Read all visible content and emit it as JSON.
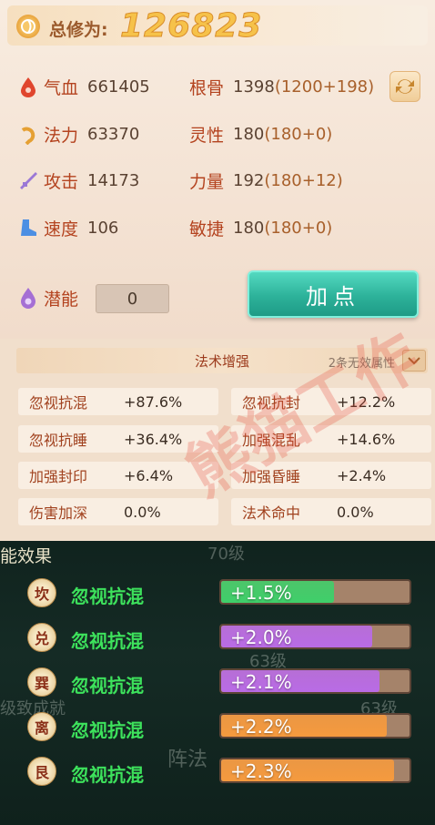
{
  "header": {
    "label": "总修为:",
    "value": "126823"
  },
  "stats": {
    "hp": {
      "name": "气血",
      "value": "661405"
    },
    "mp": {
      "name": "法力",
      "value": "63370"
    },
    "atk": {
      "name": "攻击",
      "value": "14173"
    },
    "spd": {
      "name": "速度",
      "value": "106"
    },
    "root": {
      "name": "根骨",
      "value": "1398",
      "detail": "(1200+198)"
    },
    "spirit": {
      "name": "灵性",
      "value": "180",
      "detail": "(180+0)"
    },
    "power": {
      "name": "力量",
      "value": "192",
      "detail": "(180+12)"
    },
    "agi": {
      "name": "敏捷",
      "value": "180",
      "detail": "(180+0)"
    }
  },
  "potential": {
    "name": "潜能",
    "value": "0"
  },
  "add_button": "加点",
  "magic": {
    "title": "法术增强",
    "hint": "2条无效属性",
    "cells": [
      {
        "name": "忽视抗混",
        "value": "+87.6%"
      },
      {
        "name": "忽视抗封",
        "value": "+12.2%"
      },
      {
        "name": "忽视抗睡",
        "value": "+36.4%"
      },
      {
        "name": "加强混乱",
        "value": "+14.6%"
      },
      {
        "name": "加强封印",
        "value": "+6.4%"
      },
      {
        "name": "加强昏睡",
        "value": "+2.4%"
      },
      {
        "name": "伤害加深",
        "value": "0.0%"
      },
      {
        "name": "法术命中",
        "value": "0.0%"
      }
    ]
  },
  "background_text": {
    "effect": "能效果",
    "level70": "70级",
    "level63": "63级",
    "level63b": "63级",
    "achievement": "级致成就",
    "formation": "阵法"
  },
  "trigram_rows": [
    {
      "symbol": "坎",
      "label": "忽视抗混",
      "bonus": "+1.5%",
      "color": "#3fcf6a",
      "fill": 0.6
    },
    {
      "symbol": "兑",
      "label": "忽视抗混",
      "bonus": "+2.0%",
      "color": "#b96be6",
      "fill": 0.8
    },
    {
      "symbol": "巽",
      "label": "忽视抗混",
      "bonus": "+2.1%",
      "color": "#b96be6",
      "fill": 0.84
    },
    {
      "symbol": "离",
      "label": "忽视抗混",
      "bonus": "+2.2%",
      "color": "#f59a3e",
      "fill": 0.88
    },
    {
      "symbol": "艮",
      "label": "忽视抗混",
      "bonus": "+2.3%",
      "color": "#f59a3e",
      "fill": 0.92
    }
  ],
  "watermark": "熊猫工作"
}
